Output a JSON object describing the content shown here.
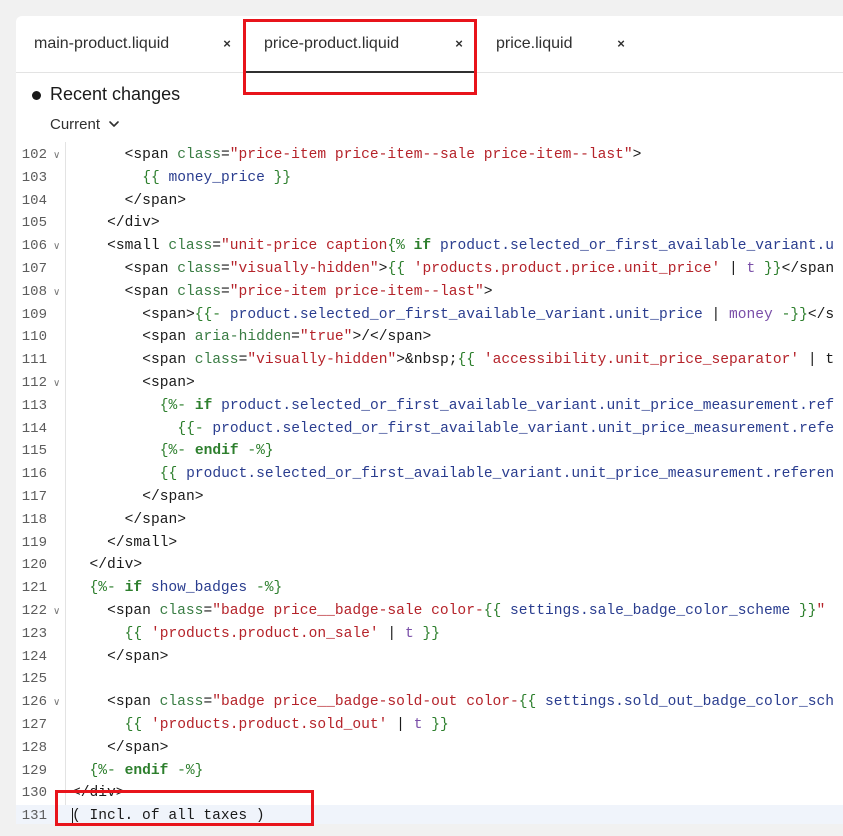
{
  "tabs": [
    {
      "label": "main-product.liquid",
      "close": "×",
      "active": false
    },
    {
      "label": "price-product.liquid",
      "close": "×",
      "active": true
    },
    {
      "label": "price.liquid",
      "close": "×",
      "active": false
    }
  ],
  "recent": {
    "title": "Recent changes",
    "version": "Current"
  },
  "code_lines": [
    {
      "n": "102",
      "fold": true,
      "indent": 6,
      "tokens": [
        [
          "tag",
          "<span "
        ],
        [
          "attr",
          "class"
        ],
        [
          "tag",
          "="
        ],
        [
          "str",
          "\"price-item price-item--sale price-item--last\""
        ],
        [
          "tag",
          ">"
        ]
      ]
    },
    {
      "n": "103",
      "fold": false,
      "indent": 8,
      "tokens": [
        [
          "delim",
          "{{ "
        ],
        [
          "var",
          "money_price"
        ],
        [
          "delim",
          " }}"
        ]
      ]
    },
    {
      "n": "104",
      "fold": false,
      "indent": 6,
      "tokens": [
        [
          "tag",
          "</span>"
        ]
      ]
    },
    {
      "n": "105",
      "fold": false,
      "indent": 4,
      "tokens": [
        [
          "tag",
          "</div>"
        ]
      ]
    },
    {
      "n": "106",
      "fold": true,
      "indent": 4,
      "tokens": [
        [
          "tag",
          "<small "
        ],
        [
          "attr",
          "class"
        ],
        [
          "tag",
          "="
        ],
        [
          "str",
          "\"unit-price caption"
        ],
        [
          "delim",
          "{% "
        ],
        [
          "kw",
          "if"
        ],
        [
          "var",
          " product.selected_or_first_available_variant.u"
        ]
      ]
    },
    {
      "n": "107",
      "fold": false,
      "indent": 6,
      "tokens": [
        [
          "tag",
          "<span "
        ],
        [
          "attr",
          "class"
        ],
        [
          "tag",
          "="
        ],
        [
          "str",
          "\"visually-hidden\""
        ],
        [
          "tag",
          ">"
        ],
        [
          "delim",
          "{{ "
        ],
        [
          "str",
          "'products.product.price.unit_price'"
        ],
        [
          "text",
          " | "
        ],
        [
          "filter",
          "t"
        ],
        [
          "delim",
          " }}"
        ],
        [
          "tag",
          "</span"
        ]
      ]
    },
    {
      "n": "108",
      "fold": true,
      "indent": 6,
      "tokens": [
        [
          "tag",
          "<span "
        ],
        [
          "attr",
          "class"
        ],
        [
          "tag",
          "="
        ],
        [
          "str",
          "\"price-item price-item--last\""
        ],
        [
          "tag",
          ">"
        ]
      ]
    },
    {
      "n": "109",
      "fold": false,
      "indent": 8,
      "tokens": [
        [
          "tag",
          "<span>"
        ],
        [
          "delim",
          "{{- "
        ],
        [
          "var",
          "product.selected_or_first_available_variant.unit_price"
        ],
        [
          "text",
          " | "
        ],
        [
          "filter",
          "money"
        ],
        [
          "delim",
          " -}}"
        ],
        [
          "tag",
          "</s"
        ]
      ]
    },
    {
      "n": "110",
      "fold": false,
      "indent": 8,
      "tokens": [
        [
          "tag",
          "<span "
        ],
        [
          "attr",
          "aria-hidden"
        ],
        [
          "tag",
          "="
        ],
        [
          "str",
          "\"true\""
        ],
        [
          "tag",
          ">/</span>"
        ]
      ]
    },
    {
      "n": "111",
      "fold": false,
      "indent": 8,
      "tokens": [
        [
          "tag",
          "<span "
        ],
        [
          "attr",
          "class"
        ],
        [
          "tag",
          "="
        ],
        [
          "str",
          "\"visually-hidden\""
        ],
        [
          "tag",
          ">&nbsp;"
        ],
        [
          "delim",
          "{{ "
        ],
        [
          "str",
          "'accessibility.unit_price_separator'"
        ],
        [
          "text",
          " | t"
        ]
      ]
    },
    {
      "n": "112",
      "fold": true,
      "indent": 8,
      "tokens": [
        [
          "tag",
          "<span>"
        ]
      ]
    },
    {
      "n": "113",
      "fold": false,
      "indent": 10,
      "tokens": [
        [
          "delim",
          "{%- "
        ],
        [
          "kw",
          "if"
        ],
        [
          "var",
          " product.selected_or_first_available_variant.unit_price_measurement.ref"
        ]
      ]
    },
    {
      "n": "114",
      "fold": false,
      "indent": 12,
      "tokens": [
        [
          "delim",
          "{{- "
        ],
        [
          "var",
          "product.selected_or_first_available_variant.unit_price_measurement.refe"
        ]
      ]
    },
    {
      "n": "115",
      "fold": false,
      "indent": 10,
      "tokens": [
        [
          "delim",
          "{%- "
        ],
        [
          "kw",
          "endif"
        ],
        [
          "delim",
          " -%}"
        ]
      ]
    },
    {
      "n": "116",
      "fold": false,
      "indent": 10,
      "tokens": [
        [
          "delim",
          "{{ "
        ],
        [
          "var",
          "product.selected_or_first_available_variant.unit_price_measurement.referen"
        ]
      ]
    },
    {
      "n": "117",
      "fold": false,
      "indent": 8,
      "tokens": [
        [
          "tag",
          "</span>"
        ]
      ]
    },
    {
      "n": "118",
      "fold": false,
      "indent": 6,
      "tokens": [
        [
          "tag",
          "</span>"
        ]
      ]
    },
    {
      "n": "119",
      "fold": false,
      "indent": 4,
      "tokens": [
        [
          "tag",
          "</small>"
        ]
      ]
    },
    {
      "n": "120",
      "fold": false,
      "indent": 2,
      "tokens": [
        [
          "tag",
          "</div>"
        ]
      ]
    },
    {
      "n": "121",
      "fold": false,
      "indent": 2,
      "tokens": [
        [
          "delim",
          "{%- "
        ],
        [
          "kw",
          "if"
        ],
        [
          "var",
          " show_badges"
        ],
        [
          "delim",
          " -%}"
        ]
      ]
    },
    {
      "n": "122",
      "fold": true,
      "indent": 4,
      "tokens": [
        [
          "tag",
          "<span "
        ],
        [
          "attr",
          "class"
        ],
        [
          "tag",
          "="
        ],
        [
          "str",
          "\"badge price__badge-sale color-"
        ],
        [
          "delim",
          "{{ "
        ],
        [
          "var",
          "settings.sale_badge_color_scheme"
        ],
        [
          "delim",
          " }}"
        ],
        [
          "str",
          "\""
        ]
      ]
    },
    {
      "n": "123",
      "fold": false,
      "indent": 6,
      "tokens": [
        [
          "delim",
          "{{ "
        ],
        [
          "str",
          "'products.product.on_sale'"
        ],
        [
          "text",
          " | "
        ],
        [
          "filter",
          "t"
        ],
        [
          "delim",
          " }}"
        ]
      ]
    },
    {
      "n": "124",
      "fold": false,
      "indent": 4,
      "tokens": [
        [
          "tag",
          "</span>"
        ]
      ]
    },
    {
      "n": "125",
      "fold": false,
      "indent": 0,
      "tokens": []
    },
    {
      "n": "126",
      "fold": true,
      "indent": 4,
      "tokens": [
        [
          "tag",
          "<span "
        ],
        [
          "attr",
          "class"
        ],
        [
          "tag",
          "="
        ],
        [
          "str",
          "\"badge price__badge-sold-out color-"
        ],
        [
          "delim",
          "{{ "
        ],
        [
          "var",
          "settings.sold_out_badge_color_sch"
        ]
      ]
    },
    {
      "n": "127",
      "fold": false,
      "indent": 6,
      "tokens": [
        [
          "delim",
          "{{ "
        ],
        [
          "str",
          "'products.product.sold_out'"
        ],
        [
          "text",
          " | "
        ],
        [
          "filter",
          "t"
        ],
        [
          "delim",
          " }}"
        ]
      ]
    },
    {
      "n": "128",
      "fold": false,
      "indent": 4,
      "tokens": [
        [
          "tag",
          "</span>"
        ]
      ]
    },
    {
      "n": "129",
      "fold": false,
      "indent": 2,
      "tokens": [
        [
          "delim",
          "{%- "
        ],
        [
          "kw",
          "endif"
        ],
        [
          "delim",
          " -%}"
        ]
      ]
    },
    {
      "n": "130",
      "fold": false,
      "indent": 0,
      "tokens": [
        [
          "tag",
          "</div>"
        ]
      ]
    },
    {
      "n": "131",
      "fold": false,
      "indent": 0,
      "current": true,
      "tokens": [
        [
          "text",
          "( Incl. of all taxes )"
        ]
      ]
    }
  ],
  "colors": {
    "highlight_box": "#e8141b",
    "current_line": "#f0f4fb"
  }
}
